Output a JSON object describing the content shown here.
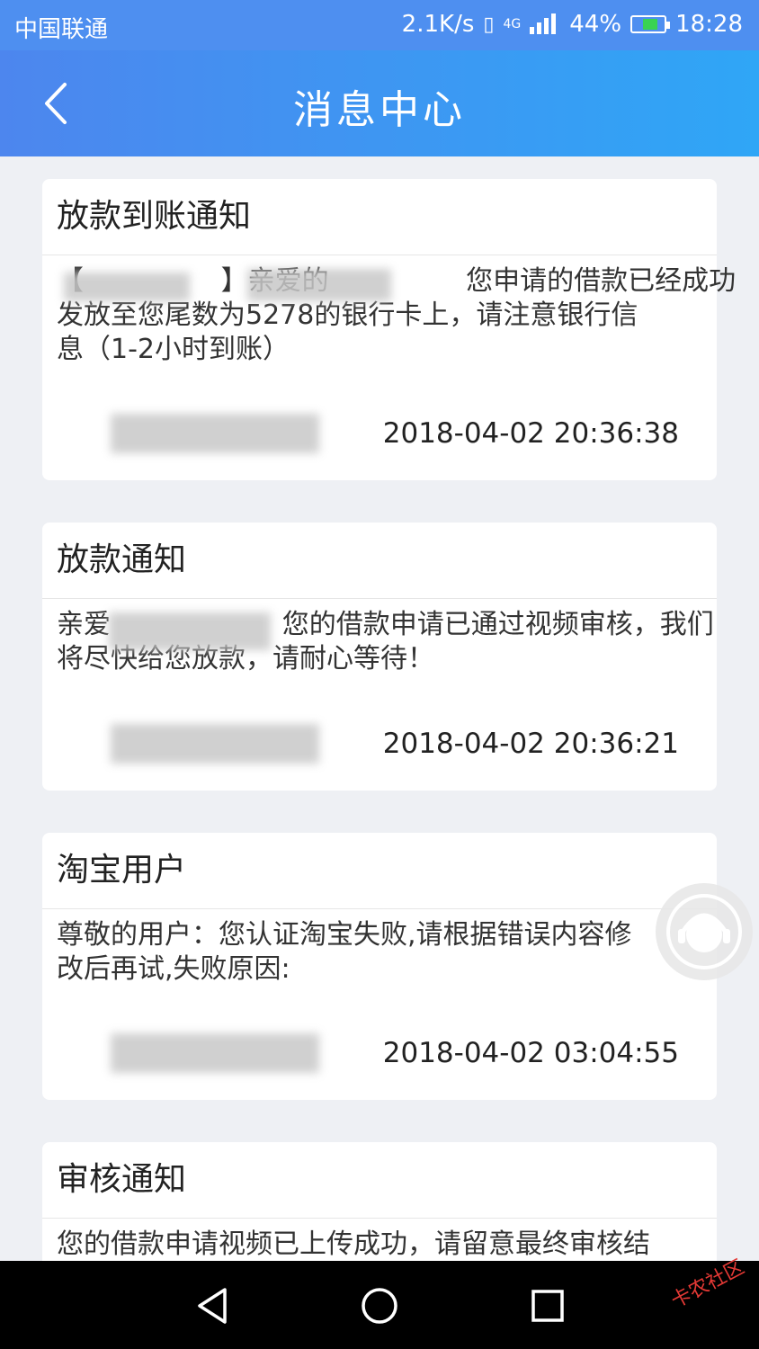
{
  "status_bar": {
    "carrier": "中国联通",
    "net_speed": "2.1K/s",
    "net_type": "4G",
    "battery": "44%",
    "time": "18:28"
  },
  "header": {
    "title": "消息中心",
    "back_icon": "chevron-left-icon"
  },
  "messages": [
    {
      "title": "放款到账通知",
      "body_line1": "【                】亲爱的                您申请的借款已经成功",
      "body_line2": "发放至您尾数为5278的银行卡上，请注意银行信",
      "body_line3": "息（1-2小时到账）",
      "source": "",
      "time": "2018-04-02 20:36:38"
    },
    {
      "title": "放款通知",
      "body_line1": "亲爱                    您的借款申请已通过视频审核，我们",
      "body_line2": "将尽快给您放款，请耐心等待！",
      "source": "",
      "time": "2018-04-02 20:36:21"
    },
    {
      "title": "淘宝用户",
      "body_line1": "尊敬的用户：您认证淘宝失败,请根据错误内容修",
      "body_line2": "改后再试,失败原因:",
      "source": "",
      "time": "2018-04-02 03:04:55"
    },
    {
      "title": "审核通知",
      "body_line1": "您的借款申请视频已上传成功，请留意最终审核结",
      "time": ""
    }
  ],
  "floating_button_icon": "customer-service-icon",
  "nav_bar": {
    "back_icon": "triangle-back-icon",
    "home_icon": "circle-home-icon",
    "recents_icon": "square-recents-icon"
  },
  "watermark": "卡农社区",
  "colors": {
    "header_start": "#4d86ee",
    "header_end": "#2fa6f6",
    "background": "#eef0f4"
  }
}
